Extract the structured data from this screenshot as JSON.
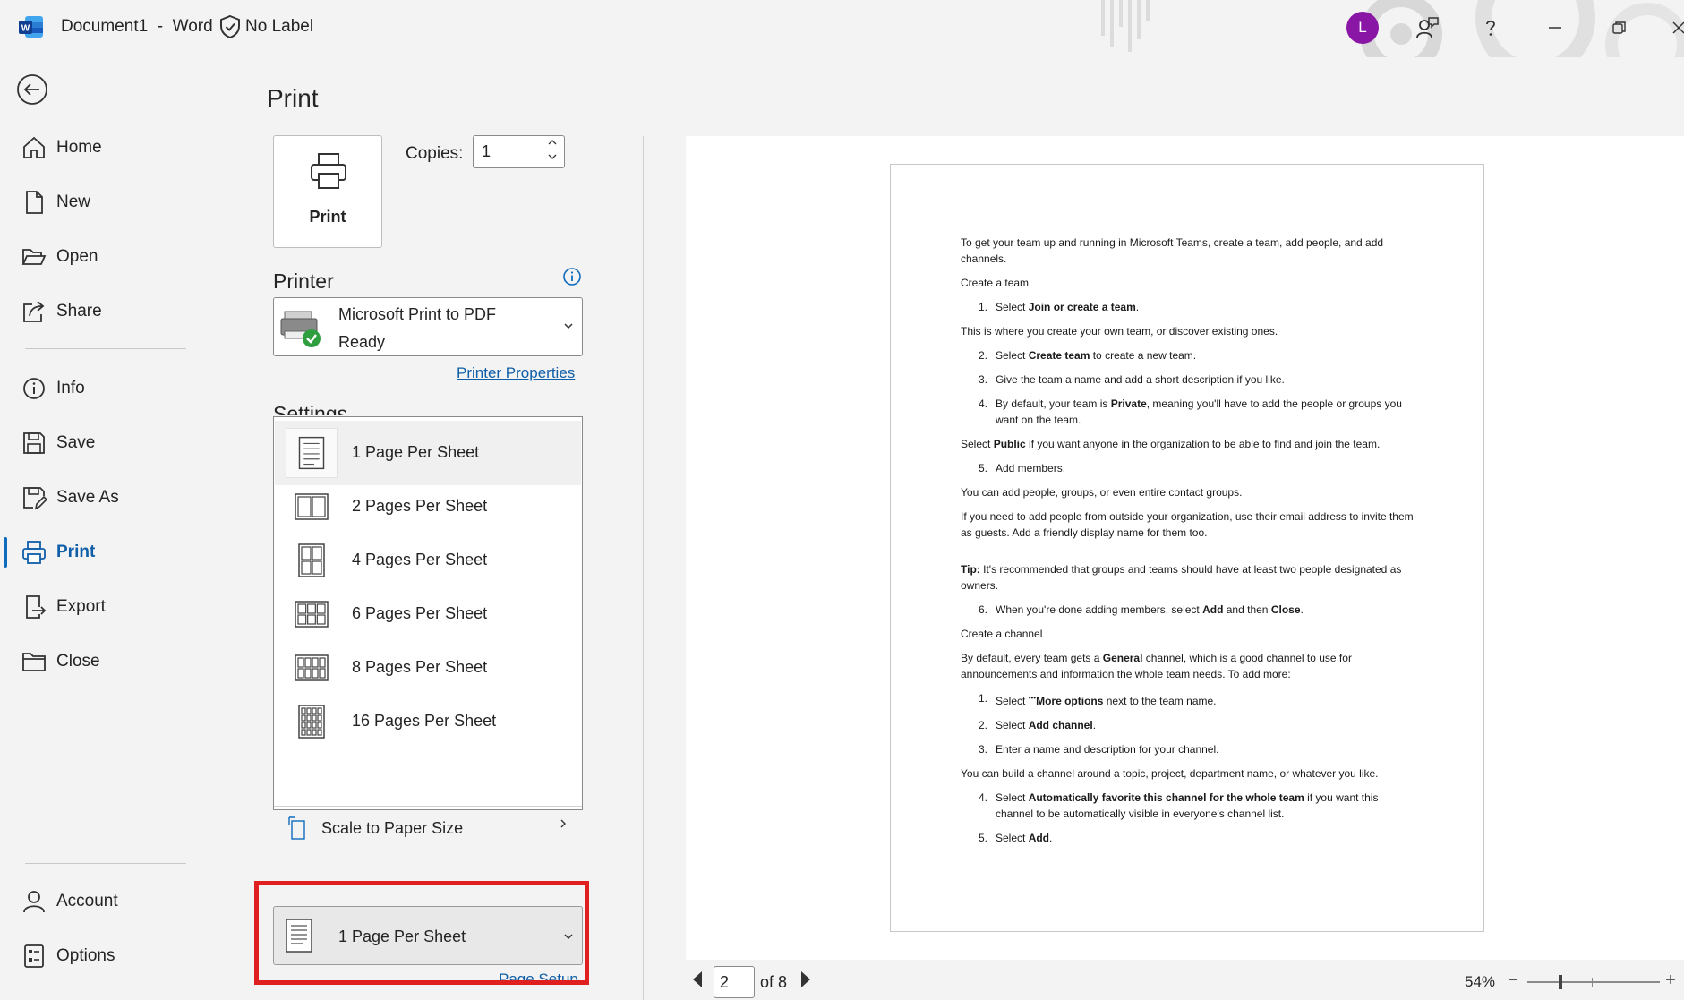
{
  "titlebar": {
    "doc_name": "Document1",
    "separator": "-",
    "app_name": "Word",
    "label": "No Label",
    "avatar_initial": "L"
  },
  "nav": {
    "items": [
      {
        "label": "Home",
        "icon": "home-icon"
      },
      {
        "label": "New",
        "icon": "new-document-icon"
      },
      {
        "label": "Open",
        "icon": "folder-open-icon"
      },
      {
        "label": "Share",
        "icon": "share-icon"
      },
      {
        "label": "Info",
        "icon": "info-icon"
      },
      {
        "label": "Save",
        "icon": "save-icon"
      },
      {
        "label": "Save As",
        "icon": "save-as-icon"
      },
      {
        "label": "Print",
        "icon": "printer-icon",
        "active": true
      },
      {
        "label": "Export",
        "icon": "export-icon"
      },
      {
        "label": "Close",
        "icon": "folder-close-icon"
      }
    ],
    "bottom": [
      {
        "label": "Account",
        "icon": "account-icon"
      },
      {
        "label": "Options",
        "icon": "options-icon"
      }
    ]
  },
  "print": {
    "title": "Print",
    "button_label": "Print",
    "copies_label": "Copies:",
    "copies_value": "1",
    "printer_heading": "Printer",
    "printer_name": "Microsoft Print to PDF",
    "printer_status": "Ready",
    "printer_properties": "Printer Properties",
    "settings_heading": "Settings",
    "pages_per_sheet_options": [
      {
        "label": "1 Page Per Sheet",
        "cols": 1,
        "rows": 1,
        "selected": true
      },
      {
        "label": "2 Pages Per Sheet",
        "cols": 2,
        "rows": 1
      },
      {
        "label": "4 Pages Per Sheet",
        "cols": 2,
        "rows": 2
      },
      {
        "label": "6 Pages Per Sheet",
        "cols": 3,
        "rows": 2
      },
      {
        "label": "8 Pages Per Sheet",
        "cols": 4,
        "rows": 2
      },
      {
        "label": "16 Pages Per Sheet",
        "cols": 4,
        "rows": 4
      }
    ],
    "scale_label": "Scale to Paper Size",
    "pages_per_sheet_selected": "1 Page Per Sheet",
    "page_setup": "Page Setup"
  },
  "preview": {
    "current_page": "2",
    "of_pages": "of 8",
    "zoom": "54%",
    "zoom_minus": "−",
    "zoom_plus": "+",
    "zoom_fraction": 0.25
  },
  "colors": {
    "accent": "#0f6cbd",
    "avatar": "#8a16a6",
    "highlight": "#e02020",
    "link": "#0f5ea8"
  }
}
